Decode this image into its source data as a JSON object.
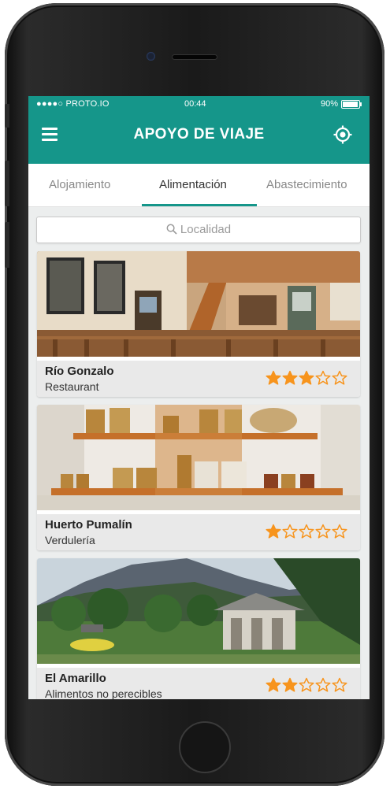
{
  "status_bar": {
    "carrier": "●●●●○ PROTO.IO",
    "time": "00:44",
    "battery": "90%"
  },
  "header": {
    "title": "APOYO DE VIAJE",
    "menu_icon": "hamburger-menu-icon",
    "location_icon": "location-target-icon"
  },
  "tabs": [
    {
      "label": "Alojamiento",
      "active": false
    },
    {
      "label": "Alimentación",
      "active": true
    },
    {
      "label": "Abastecimiento",
      "active": false
    }
  ],
  "search": {
    "placeholder": "Localidad",
    "icon": "search-icon"
  },
  "places": [
    {
      "name": "Río Gonzalo",
      "category": "Restaurant",
      "rating": 3,
      "max_rating": 5
    },
    {
      "name": "Huerto Pumalín",
      "category": "Verdulería",
      "rating": 1,
      "max_rating": 5
    },
    {
      "name": "El Amarillo",
      "category": "Alimentos no perecibles",
      "rating": 2,
      "max_rating": 5
    }
  ],
  "colors": {
    "accent": "#15968a",
    "star": "#f7941d",
    "card_footer": "#e9e9e9"
  }
}
